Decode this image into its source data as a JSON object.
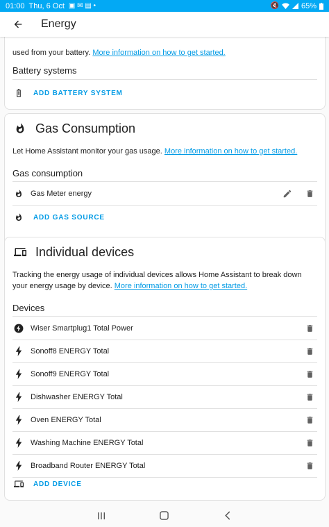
{
  "status": {
    "time": "01:00",
    "date": "Thu, 6 Oct",
    "battery": "65%"
  },
  "toolbar": {
    "title": "Energy"
  },
  "battery_card": {
    "text": "used from your battery.",
    "link": "More information on how to get started.",
    "section": "Battery systems",
    "add_label": "ADD BATTERY SYSTEM"
  },
  "gas_card": {
    "title": "Gas Consumption",
    "text": "Let Home Assistant monitor your gas usage.",
    "link": "More information on how to get started.",
    "section": "Gas consumption",
    "sources": [
      {
        "label": "Gas Meter energy"
      }
    ],
    "add_label": "ADD GAS SOURCE"
  },
  "devices_card": {
    "title": "Individual devices",
    "text": "Tracking the energy usage of individual devices allows Home Assistant to break down your energy usage by device.",
    "link": "More information on how to get started.",
    "section": "Devices",
    "devices": [
      {
        "label": "Wiser Smartplug1 Total Power",
        "icon": "lightning-circle-icon"
      },
      {
        "label": "Sonoff8 ENERGY Total",
        "icon": "lightning-bolt-icon"
      },
      {
        "label": "Sonoff9 ENERGY Total",
        "icon": "lightning-bolt-icon"
      },
      {
        "label": "Dishwasher ENERGY Total",
        "icon": "lightning-bolt-icon"
      },
      {
        "label": "Oven ENERGY Total",
        "icon": "lightning-bolt-icon"
      },
      {
        "label": "Washing Machine ENERGY Total",
        "icon": "lightning-bolt-icon"
      },
      {
        "label": "Broadband Router ENERGY Total",
        "icon": "lightning-bolt-icon"
      }
    ],
    "add_label": "ADD DEVICE"
  },
  "colors": {
    "accent": "#03a9f4",
    "link": "#039be5"
  }
}
